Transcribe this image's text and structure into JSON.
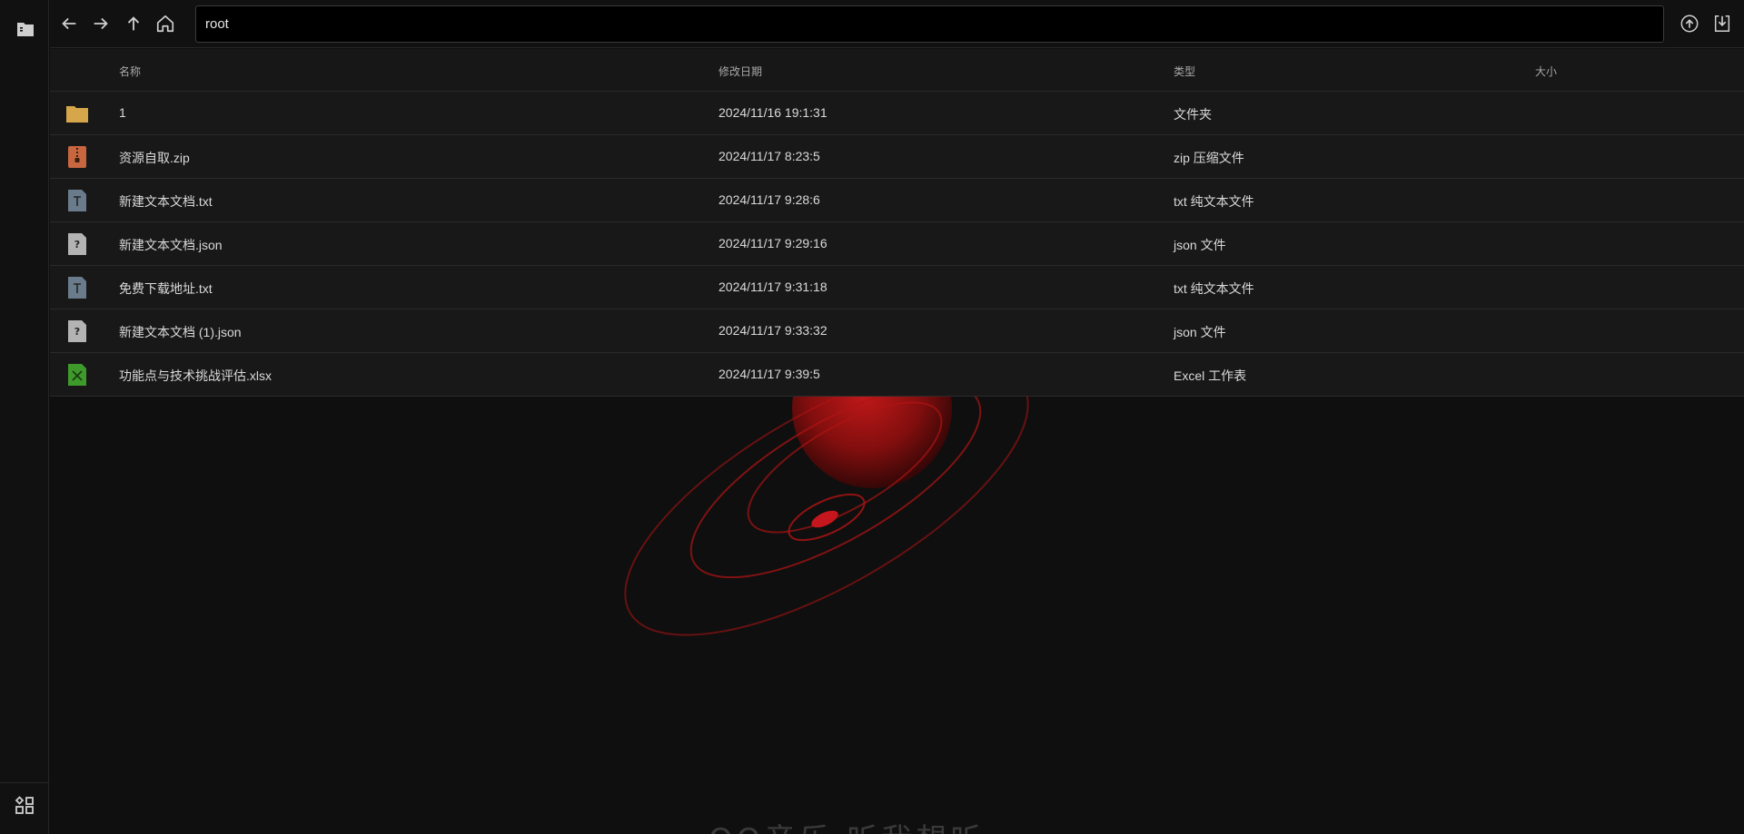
{
  "toolbar": {
    "path_value": "root",
    "icons": {
      "back": "arrow-left-icon",
      "forward": "arrow-right-icon",
      "up": "arrow-up-icon",
      "home": "home-icon",
      "upload": "upload-icon",
      "download": "download-icon"
    }
  },
  "sidebar": {
    "top_icon": "file-manager-icon",
    "bottom_icon": "apps-grid-icon"
  },
  "table": {
    "headers": {
      "name": "名称",
      "date": "修改日期",
      "type": "类型",
      "size": "大小"
    },
    "rows": [
      {
        "icon": "folder-icon",
        "name": "1",
        "date": "2024/11/16 19:1:31",
        "type": "文件夹",
        "size": ""
      },
      {
        "icon": "zip-file-icon",
        "name": "资源自取.zip",
        "date": "2024/11/17 8:23:5",
        "type": "zip 压缩文件",
        "size": ""
      },
      {
        "icon": "text-file-icon",
        "name": "新建文本文档.txt",
        "date": "2024/11/17 9:28:6",
        "type": "txt 纯文本文件",
        "size": ""
      },
      {
        "icon": "unknown-file-icon",
        "name": "新建文本文档.json",
        "date": "2024/11/17 9:29:16",
        "type": "json 文件",
        "size": ""
      },
      {
        "icon": "text-file-icon",
        "name": "免费下载地址.txt",
        "date": "2024/11/17 9:31:18",
        "type": "txt 纯文本文件",
        "size": ""
      },
      {
        "icon": "unknown-file-icon",
        "name": "新建文本文档 (1).json",
        "date": "2024/11/17 9:33:32",
        "type": "json 文件",
        "size": ""
      },
      {
        "icon": "excel-file-icon",
        "name": "功能点与技术挑战评估.xlsx",
        "date": "2024/11/17 9:39:5",
        "type": "Excel 工作表",
        "size": ""
      }
    ]
  },
  "background": {
    "watermark": "QQ音乐 听我想听",
    "accent": "#c4161c"
  },
  "colors": {
    "folder": "#d6a74a",
    "zip": "#c8673f",
    "txt": "#6a7c8c",
    "json": "#b3b3b3",
    "excel": "#3f9a2c"
  }
}
